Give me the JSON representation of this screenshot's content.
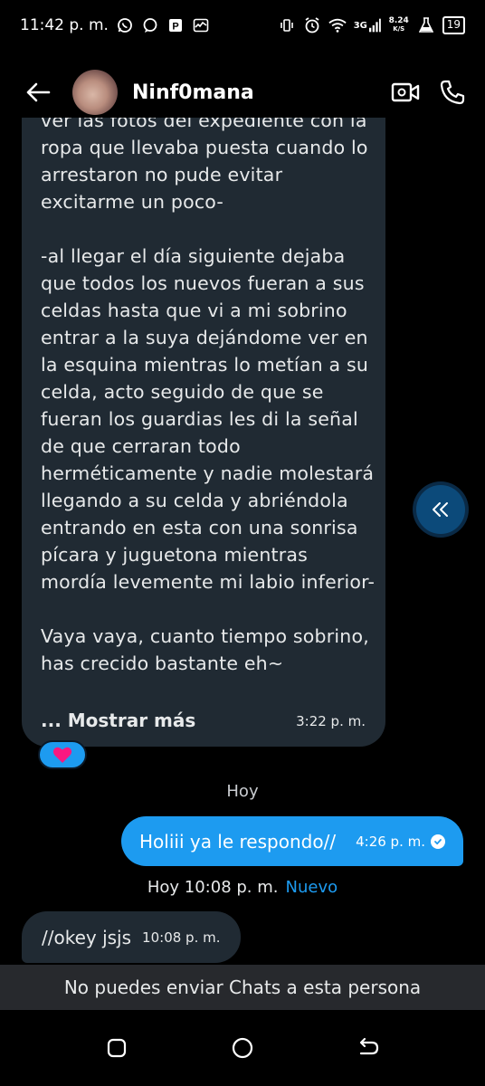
{
  "status_bar": {
    "time": "11:42 p. m.",
    "network": "3G",
    "speed_value": "8.24",
    "speed_unit": "K/S",
    "battery": "19",
    "left_icons": [
      "whatsapp-icon",
      "chat-bubble-icon",
      "app-p-icon",
      "activity-icon"
    ],
    "right_icons": [
      "vibrate-icon",
      "alarm-icon",
      "wifi-icon",
      "signal-icon",
      "lab-icon"
    ]
  },
  "header": {
    "contact_name": "Ninf0mana",
    "icons": [
      "back-arrow-icon",
      "video-call-icon",
      "phone-icon"
    ]
  },
  "messages": {
    "long_message": {
      "text": "ver las fotos del expediente con la ropa que llevaba puesta cuando lo arrestaron no pude evitar excitarme un poco-\n\n-al llegar el día siguiente dejaba que todos los nuevos fueran a sus celdas hasta que vi a mi sobrino entrar a la suya dejándome ver en la esquina mientras lo metían a su celda, acto seguido de que se fueran los guardias les di la señal de que cerraran todo herméticamente y nadie molestará llegando a su celda y abriéndola entrando en esta con una sonrisa pícara y juguetona mientras mordía levemente mi labio inferior-\n\nVaya vaya, cuanto tiempo sobrino, has crecido bastante eh~",
      "show_more": "... Mostrar más",
      "time": "3:22 p. m.",
      "reaction": "heart"
    },
    "day_separator": "Hoy",
    "outgoing": {
      "text": "Holiii ya le respondo//",
      "time": "4:26 p. m."
    },
    "new_separator": {
      "label": "Hoy 10:08 p. m.",
      "badge": "Nuevo"
    },
    "incoming_short": {
      "text": "//okey jsjs",
      "time": "10:08 p. m."
    }
  },
  "blocked_notice": "No puedes enviar Chats a esta persona",
  "nav": [
    "recents-icon",
    "home-icon",
    "back-icon"
  ],
  "colors": {
    "accent": "#1d9bf0",
    "incoming_bubble": "#202a33",
    "background": "#000000"
  }
}
